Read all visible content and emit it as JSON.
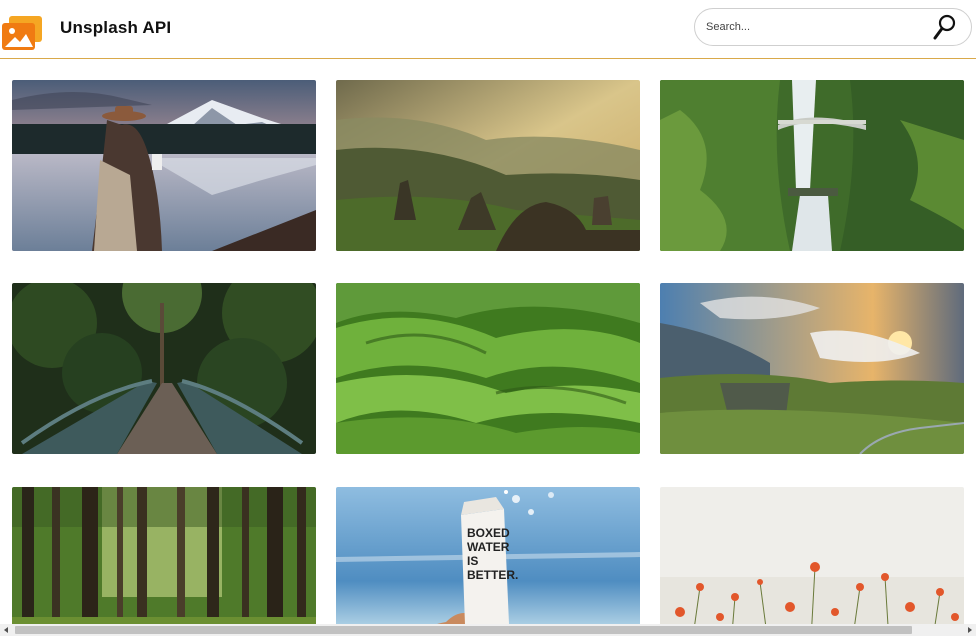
{
  "header": {
    "title": "Unsplash API",
    "logo_icon": "image-gallery-icon"
  },
  "search": {
    "placeholder": "Search...",
    "value": "",
    "icon": "magnifier-icon"
  },
  "photos": [
    {
      "subject": "woman in hat by mountain lake"
    },
    {
      "subject": "misty valley with rock formations"
    },
    {
      "subject": "waterfall with arched bridge"
    },
    {
      "subject": "wooden bridge in forest"
    },
    {
      "subject": "green rolling hills"
    },
    {
      "subject": "cliffs under sunset clouds"
    },
    {
      "subject": "sunlit pine forest"
    },
    {
      "subject": "Boxed Water carton at beach",
      "text": [
        "BOXED",
        "WATER",
        "IS",
        "BETTER."
      ]
    },
    {
      "subject": "orange poppy field"
    }
  ],
  "colors": {
    "header_border": "#d9a94a",
    "logo_orange": "#f07b12"
  }
}
